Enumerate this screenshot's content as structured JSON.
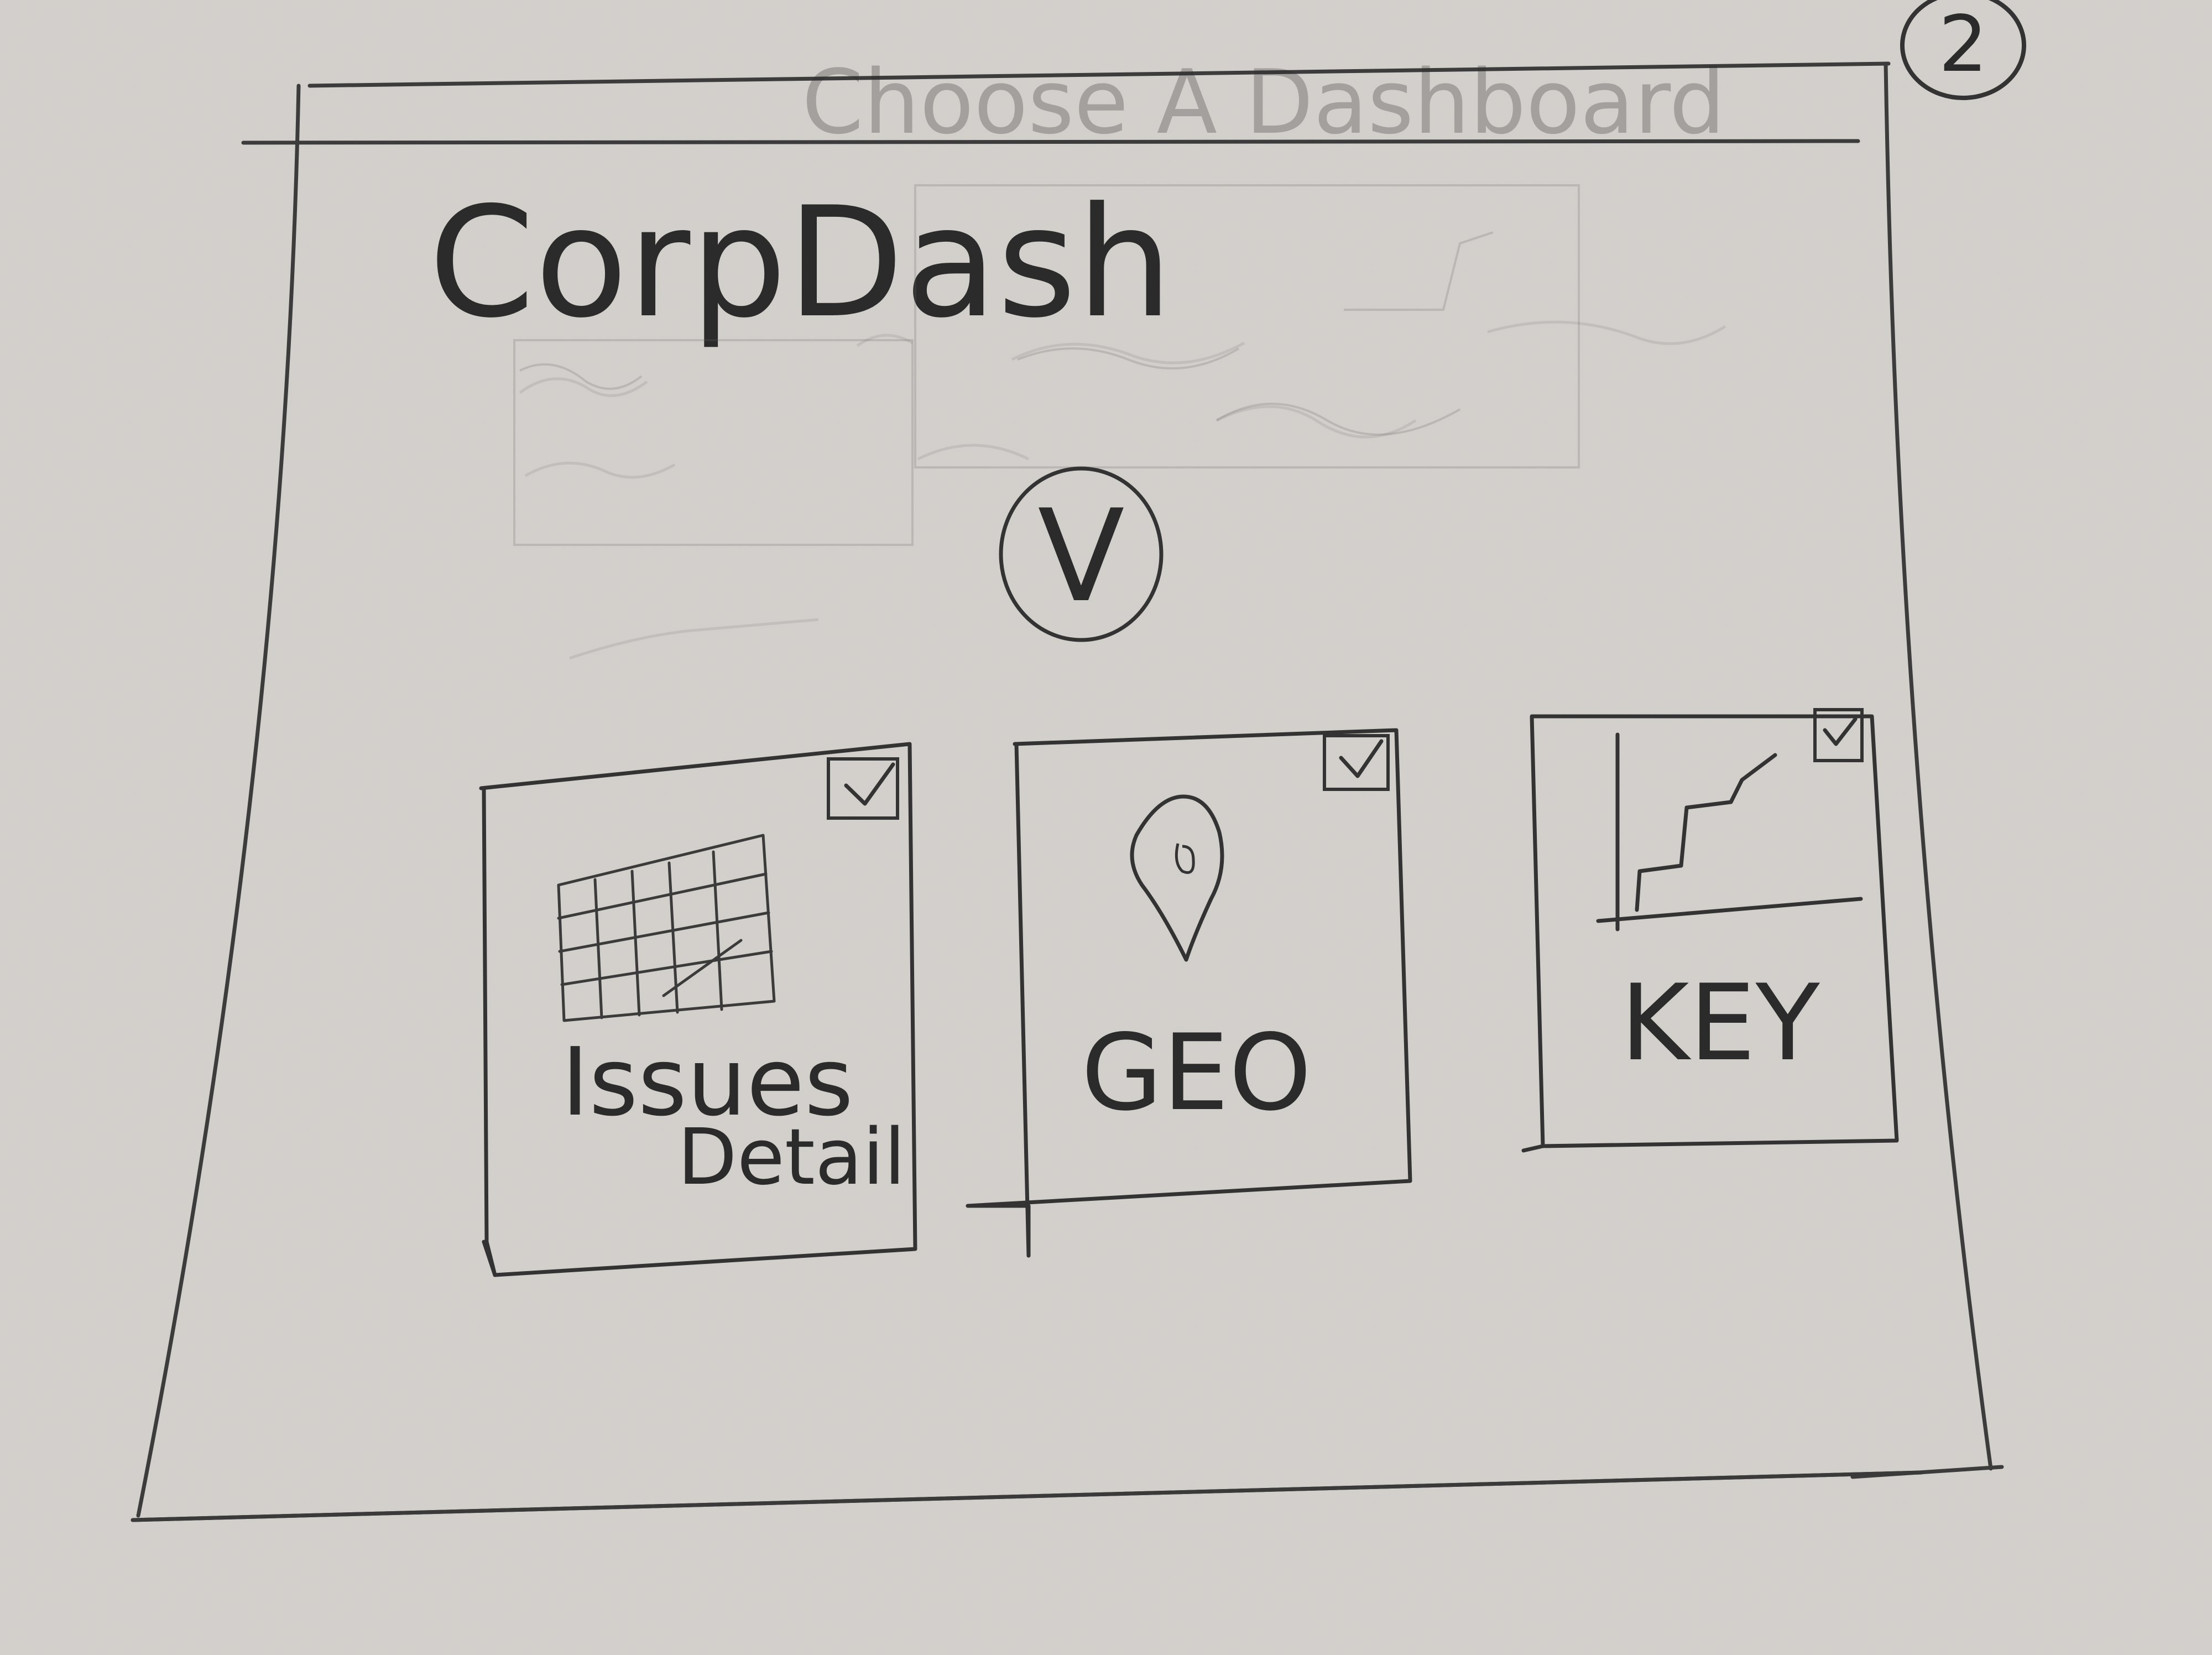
{
  "page": {
    "number": "2"
  },
  "header": {
    "title": "Choose A Dashboard"
  },
  "app": {
    "name": "CorpDash"
  },
  "dropdown": {
    "label": "V"
  },
  "cards": [
    {
      "id": "issues-detail",
      "title_line1": "Issues",
      "title_line2": "Detail",
      "icon": "grid-chart-icon",
      "checked": true
    },
    {
      "id": "geo",
      "title_line1": "GEO",
      "icon": "map-pin-icon",
      "checked": true
    },
    {
      "id": "key",
      "title_line1": "KEY",
      "icon": "step-chart-icon",
      "checked": true
    }
  ]
}
